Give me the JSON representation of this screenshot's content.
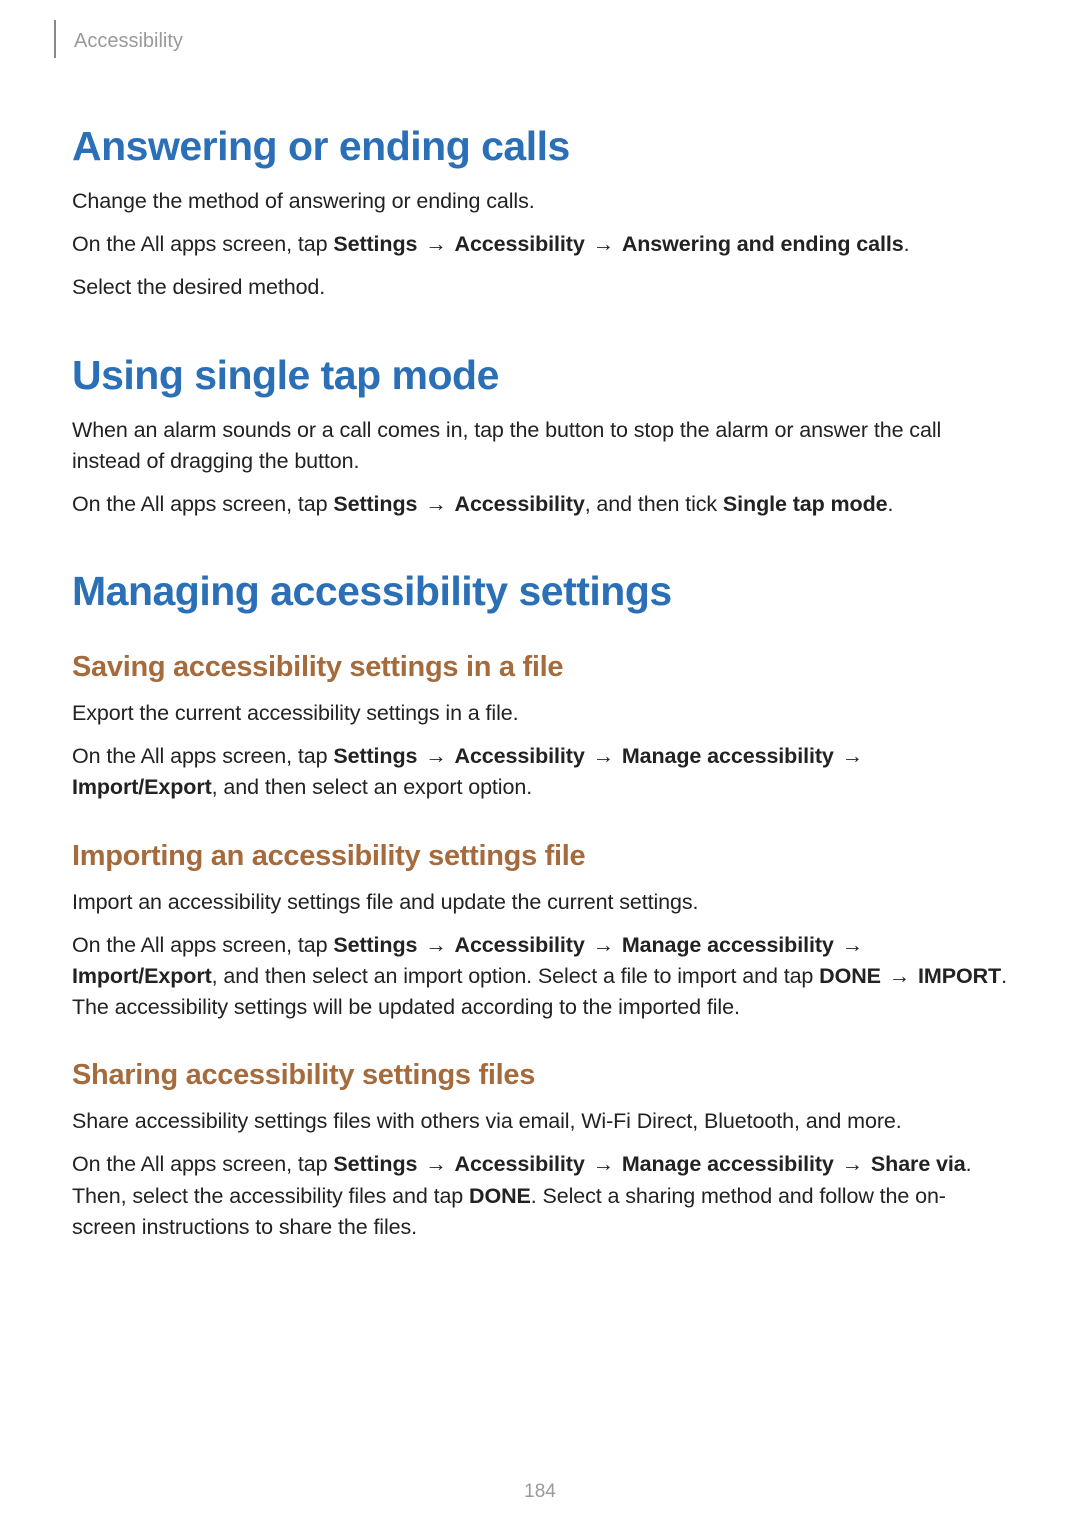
{
  "header": {
    "breadcrumb": "Accessibility"
  },
  "arrow": "→",
  "sections": {
    "answering": {
      "title": "Answering or ending calls",
      "p1": "Change the method of answering or ending calls.",
      "p2_prefix": "On the All apps screen, tap ",
      "p2_nav1": "Settings",
      "p2_nav2": "Accessibility",
      "p2_nav3": "Answering and ending calls",
      "p2_suffix": ".",
      "p3": "Select the desired method."
    },
    "singletap": {
      "title": "Using single tap mode",
      "p1": "When an alarm sounds or a call comes in, tap the button to stop the alarm or answer the call instead of dragging the button.",
      "p2_prefix": "On the All apps screen, tap ",
      "p2_nav1": "Settings",
      "p2_nav2": "Accessibility",
      "p2_mid": ", and then tick ",
      "p2_nav3": "Single tap mode",
      "p2_suffix": "."
    },
    "managing": {
      "title": "Managing accessibility settings",
      "saving": {
        "title": "Saving accessibility settings in a file",
        "p1": "Export the current accessibility settings in a file.",
        "p2_prefix": "On the All apps screen, tap ",
        "nav1": "Settings",
        "nav2": "Accessibility",
        "nav3": "Manage accessibility",
        "nav4": "Import/Export",
        "p2_suffix": ", and then select an export option."
      },
      "importing": {
        "title": "Importing an accessibility settings file",
        "p1": "Import an accessibility settings file and update the current settings.",
        "p2_prefix": "On the All apps screen, tap ",
        "nav1": "Settings",
        "nav2": "Accessibility",
        "nav3": "Manage accessibility",
        "nav4": "Import/Export",
        "p2_mid": ", and then select an import option. Select a file to import and tap ",
        "nav5": "DONE",
        "nav6": "IMPORT",
        "p2_suffix": ". The accessibility settings will be updated according to the imported file."
      },
      "sharing": {
        "title": "Sharing accessibility settings files",
        "p1": "Share accessibility settings files with others via email, Wi-Fi Direct, Bluetooth, and more.",
        "p2_prefix": "On the All apps screen, tap ",
        "nav1": "Settings",
        "nav2": "Accessibility",
        "nav3": "Manage accessibility",
        "nav4": "Share via",
        "p2_mid": ". Then, select the accessibility files and tap ",
        "nav5": "DONE",
        "p2_suffix": ". Select a sharing method and follow the on-screen instructions to share the files."
      }
    }
  },
  "page_number": "184"
}
